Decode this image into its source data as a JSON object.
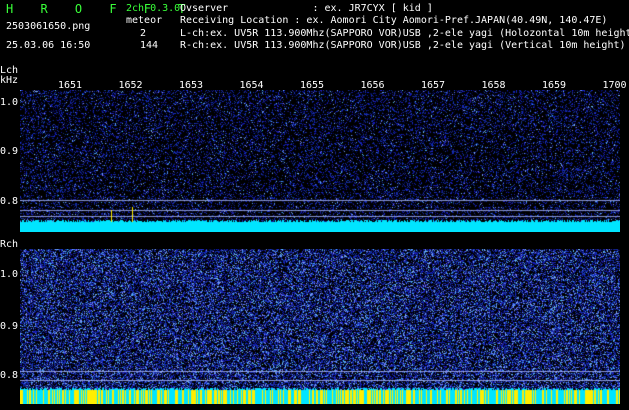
{
  "header": {
    "app_title": "H R O F F T",
    "file_name": "2503061650.png",
    "datetime": "25.03.06 16:50",
    "channel_info": "2ch 0.3.0",
    "mode_label": "meteor",
    "count_top": "2",
    "count_bottom": "144",
    "observer": "Ovserver              : ex. JR7CYX [ kid ]",
    "receiving_location": "Receiving Location : ex. Aomori City Aomori-Pref.JAPAN(40.49N, 140.47E)",
    "lch_info": "L-ch:ex. UV5R 113.900Mhz(SAPPORO VOR)USB ,2-ele yagi (Holozontal 10m height)",
    "rch_info": "R-ch:ex. UV5R 113.900Mhz(SAPPORO VOR)USB ,2-ele yagi (Vertical 10m height)"
  },
  "lch": {
    "label": "Lch",
    "unit": "kHz",
    "y_ticks": [
      "1.0",
      "0.9",
      "0.8"
    ]
  },
  "rch": {
    "label": "Rch",
    "y_ticks": [
      "1.0",
      "0.9",
      "0.8"
    ]
  },
  "time_axis": [
    "1651",
    "1652",
    "1653",
    "1654",
    "1655",
    "1656",
    "1657",
    "1658",
    "1659",
    "1700"
  ],
  "colors": {
    "background": "#000000",
    "header_green": "#39ff39",
    "noise_blue": "#0a1a8a",
    "baseline_cyan": "#00e5ff",
    "baseline_yellow": "#ffee00"
  }
}
